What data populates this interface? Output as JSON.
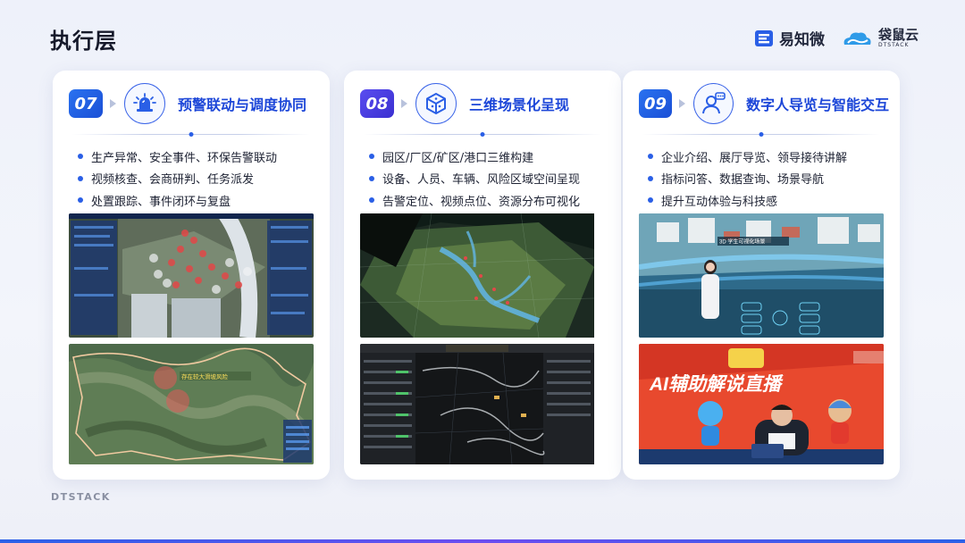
{
  "page": {
    "title": "执行层",
    "footer_brand": "DTSTACK"
  },
  "logos": [
    {
      "name": "易知微"
    },
    {
      "name": "袋鼠云",
      "sub": "DTSTACK"
    }
  ],
  "cards": [
    {
      "number": "07",
      "icon": "alarm-light-icon",
      "title": "预警联动与调度协同",
      "bullets": [
        "生产异常、安全事件、环保告警联动",
        "视频核查、会商研判、任务派发",
        "处置跟踪、事件闭环与复盘"
      ],
      "screenshots": [
        {
          "type": "3d-park-alarm-dashboard"
        },
        {
          "type": "terrain-map",
          "label": "存在较大滑坡风险"
        }
      ]
    },
    {
      "number": "08",
      "icon": "3d-cube-icon",
      "title": "三维场景化呈现",
      "bullets": [
        "园区/厂区/矿区/港口三维构建",
        "设备、人员、车辆、风险区域空间呈现",
        "告警定位、视频点位、资源分布可视化"
      ],
      "screenshots": [
        {
          "type": "3d-terrain-river"
        },
        {
          "type": "dark-road-network-dashboard"
        }
      ]
    },
    {
      "number": "09",
      "icon": "digital-human-chat-icon",
      "title": "数字人导览与智能交互",
      "bullets": [
        "企业介绍、展厅导览、领导接待讲解",
        "指标问答、数据查询、场景导航",
        "提升互动体验与科技感"
      ],
      "screenshots": [
        {
          "type": "digital-human-3d-scene",
          "label": "3D 学生可视化场景"
        },
        {
          "type": "ai-live-stream-banner",
          "label": "AI辅助解说直播"
        }
      ]
    }
  ],
  "colors": {
    "accent": "#2a5fe6",
    "title_blue": "#1c46d8",
    "badge_purple": "#4a3fe0"
  }
}
